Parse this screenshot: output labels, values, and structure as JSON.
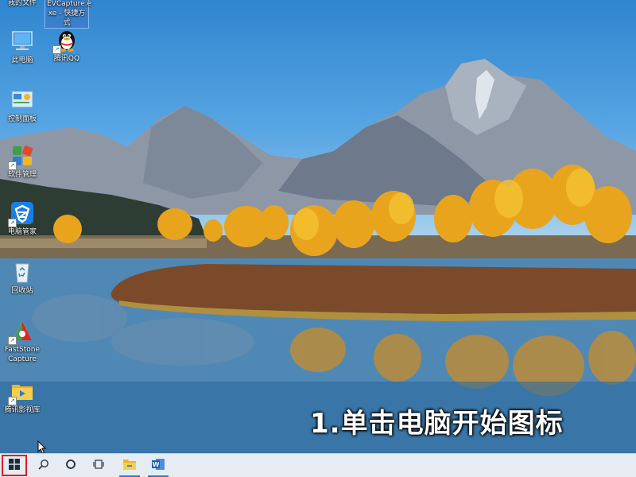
{
  "desktop": {
    "icons": [
      {
        "label": "我的文件"
      },
      {
        "label": "EVCapture.e\nxe - 快捷方式"
      },
      {
        "label": "此电脑"
      },
      {
        "label": "腾讯QQ"
      },
      {
        "label": "控制面板"
      },
      {
        "label": "软件管理"
      },
      {
        "label": "电脑管家"
      },
      {
        "label": "回收站"
      },
      {
        "label": "FastStone\nCapture"
      },
      {
        "label": "腾讯影视库"
      }
    ]
  },
  "caption": {
    "text": "1.单击电脑开始图标"
  },
  "taskbar": {
    "items": [
      {
        "icon": "windows-start-icon",
        "highlight_color": "#e12020"
      },
      {
        "icon": "search-icon"
      },
      {
        "icon": "cortana-circle-icon"
      },
      {
        "icon": "task-view-icon"
      },
      {
        "icon": "file-explorer-icon"
      },
      {
        "icon": "word-icon"
      }
    ]
  },
  "colors": {
    "sky": "#4a9ddb",
    "taskbar": "#e6ecf2",
    "start_highlight": "#e12020",
    "caption_text": "#ffffff"
  }
}
